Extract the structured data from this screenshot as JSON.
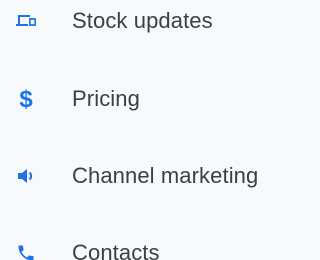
{
  "accent_color": "#1a73e8",
  "menu": {
    "items": [
      {
        "label": "Stock updates",
        "icon": "devices-icon"
      },
      {
        "label": "Pricing",
        "icon": "dollar-icon"
      },
      {
        "label": "Channel marketing",
        "icon": "speaker-icon"
      },
      {
        "label": "Contacts",
        "icon": "phone-icon"
      }
    ]
  }
}
